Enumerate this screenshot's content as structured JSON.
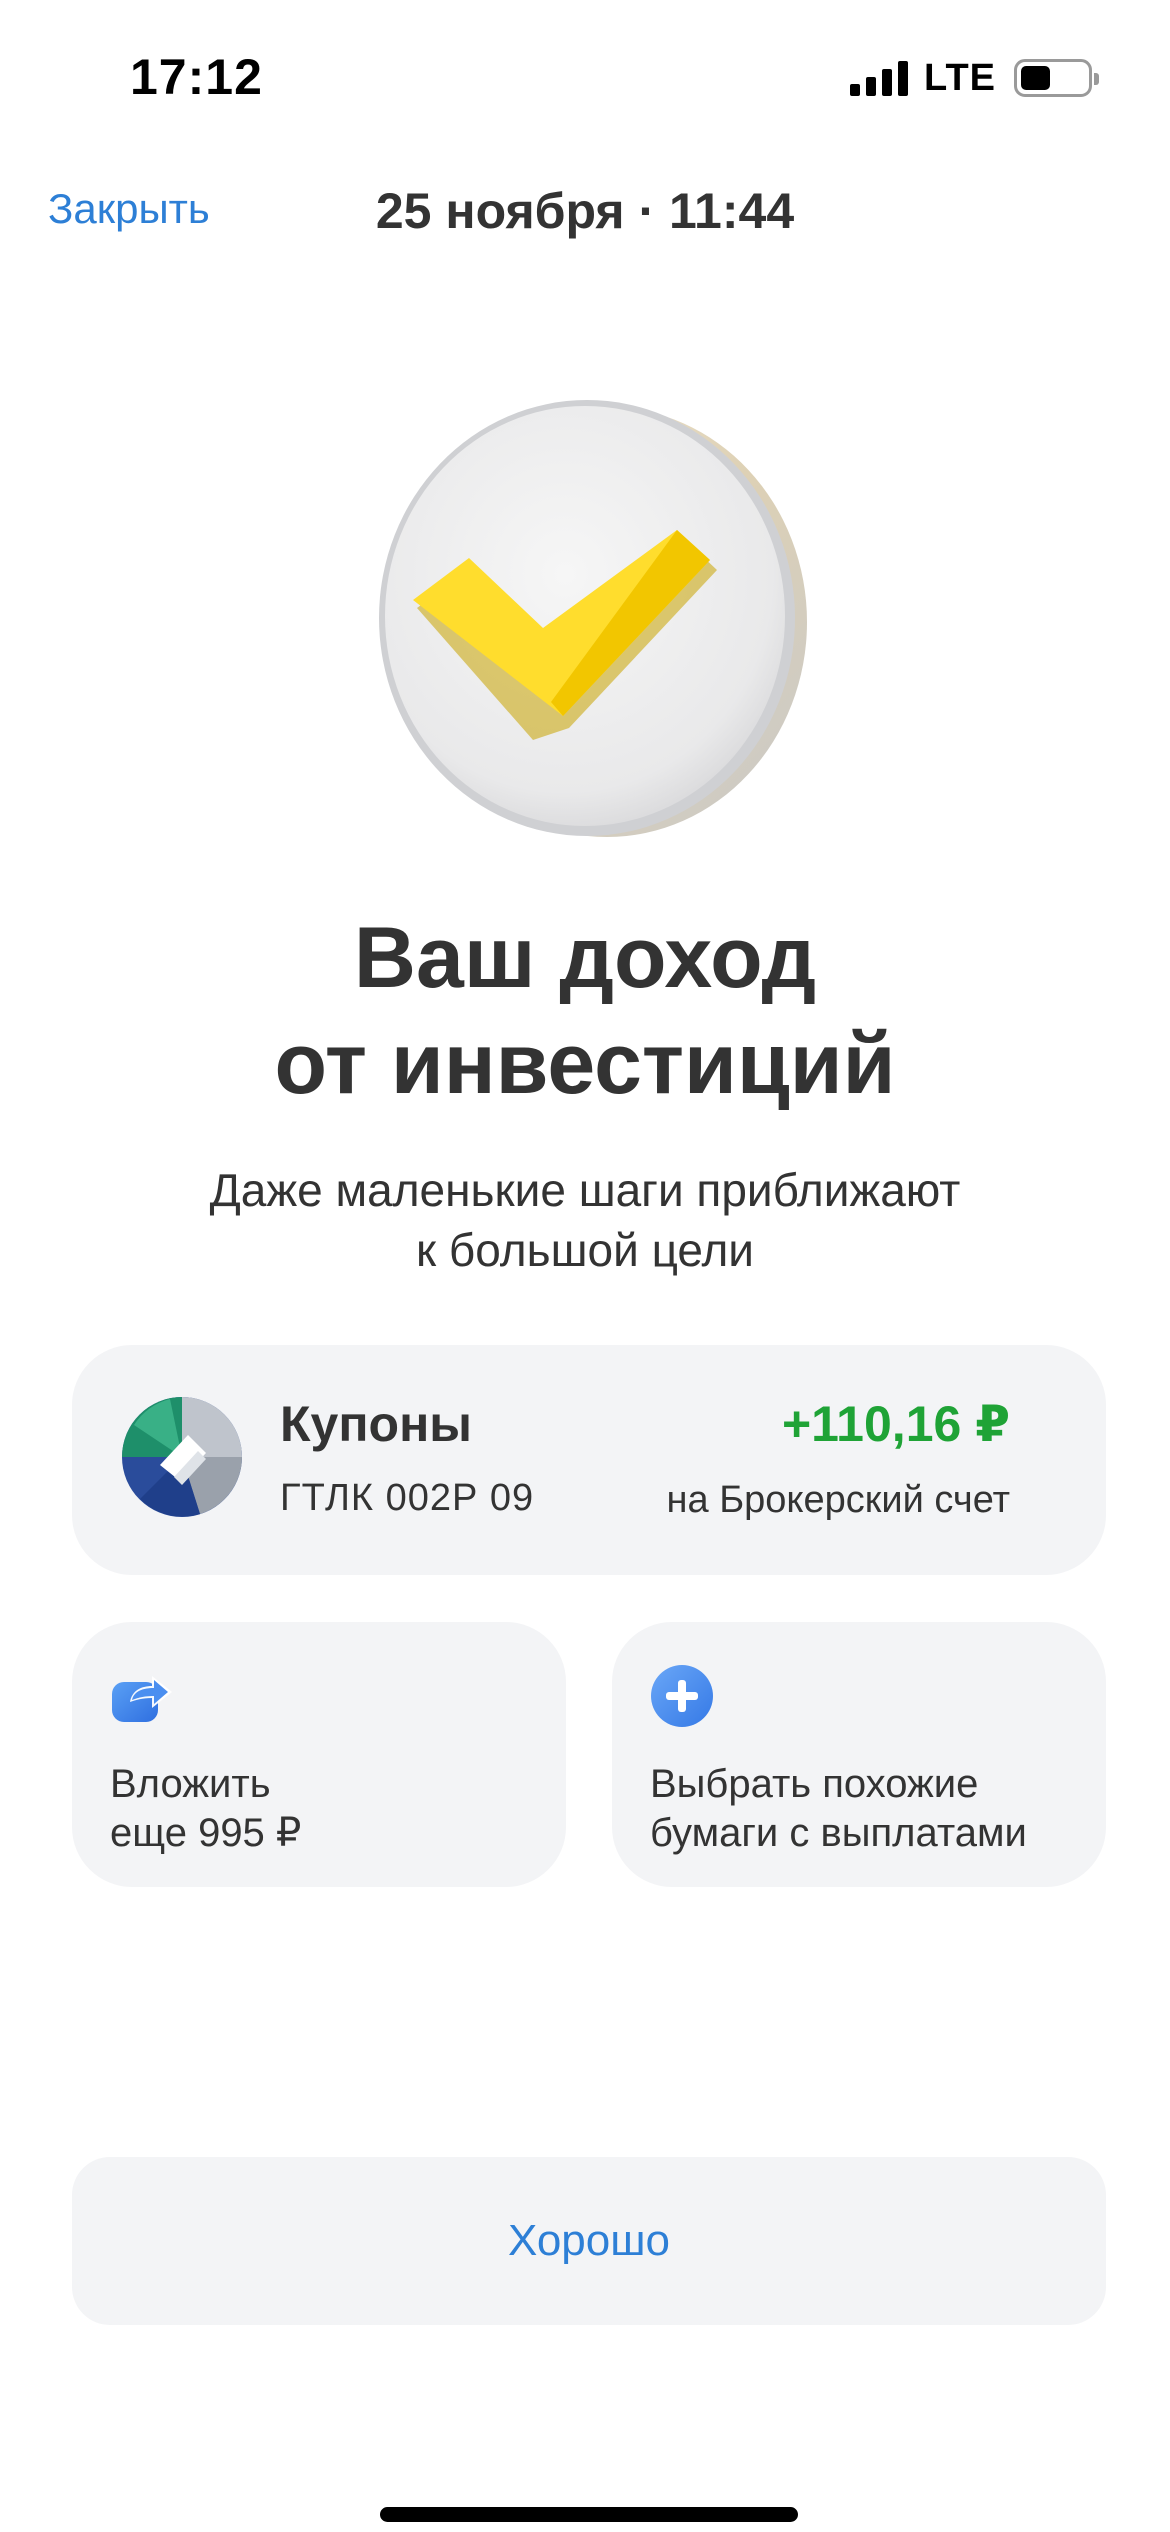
{
  "status_bar": {
    "time": "17:12",
    "network": "LTE",
    "battery_percent": 45
  },
  "header": {
    "close_label": "Закрыть",
    "title": "25 ноября · 11:44"
  },
  "hero": {
    "icon": "checkmark-coin-icon",
    "accent_color": "#FFDD2D"
  },
  "headline": {
    "line1": "Ваш доход",
    "line2": "от инвестиций"
  },
  "subtitle": {
    "line1": "Даже маленькие шаги приближают",
    "line2": "к большой цели"
  },
  "coupon": {
    "logo_icon": "gtlk-logo-icon",
    "title": "Купоны",
    "ticker": "ГТЛК 002Р 09",
    "amount": "+110,16 ₽",
    "amount_color": "#1FA336",
    "destination": "на Брокерский счет"
  },
  "actions": [
    {
      "icon": "share-arrow-icon",
      "label": "Вложить\nеще 995 ₽"
    },
    {
      "icon": "plus-circle-icon",
      "label": "Выбрать похожие\nбумаги с выплатами"
    }
  ],
  "primary_button": {
    "label": "Хорошо",
    "color": "#2D7FD6"
  }
}
